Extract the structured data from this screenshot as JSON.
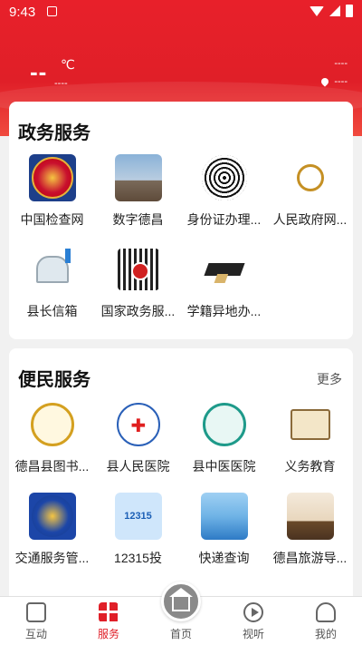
{
  "status_bar": {
    "time": "9:43"
  },
  "weather": {
    "temperature": "--",
    "unit": "℃",
    "description": "----",
    "right_info": "----",
    "location": "----"
  },
  "gov_services": {
    "title": "政务服务",
    "items": [
      {
        "label": "中国检查网",
        "icon": "procuratorate-emblem-icon"
      },
      {
        "label": "数字德昌",
        "icon": "city-tower-icon"
      },
      {
        "label": "身份证办理...",
        "icon": "fingerprint-icon"
      },
      {
        "label": "人民政府网...",
        "icon": "dechang-government-logo-icon"
      },
      {
        "label": "县长信箱",
        "icon": "mailbox-icon"
      },
      {
        "label": "国家政务服...",
        "icon": "qr-code-icon"
      },
      {
        "label": "学籍异地办...",
        "icon": "graduation-cap-icon"
      }
    ]
  },
  "public_services": {
    "title": "便民服务",
    "more": "更多",
    "items": [
      {
        "label": "德昌县图书...",
        "icon": "library-logo-icon"
      },
      {
        "label": "县人民医院",
        "icon": "hospital-logo-icon"
      },
      {
        "label": "县中医医院",
        "icon": "tcm-hospital-logo-icon"
      },
      {
        "label": "义务教育",
        "icon": "book-search-icon"
      },
      {
        "label": "交通服务管...",
        "icon": "police-emblem-icon"
      },
      {
        "label": "12315投",
        "icon": "complaint-12315-icon",
        "badge": "12315"
      },
      {
        "label": "快递查询",
        "icon": "express-city-icon"
      },
      {
        "label": "德昌旅游导...",
        "icon": "tourism-pagoda-icon"
      }
    ]
  },
  "bottom_nav": {
    "items": [
      {
        "label": "互动",
        "icon": "hashtag-icon"
      },
      {
        "label": "服务",
        "icon": "grid-icon",
        "active": true
      },
      {
        "label": "首页",
        "icon": "home-icon"
      },
      {
        "label": "视听",
        "icon": "play-icon"
      },
      {
        "label": "我的",
        "icon": "person-icon"
      }
    ]
  },
  "colors": {
    "brand_red": "#e01f28",
    "background": "#f1f1f1"
  }
}
